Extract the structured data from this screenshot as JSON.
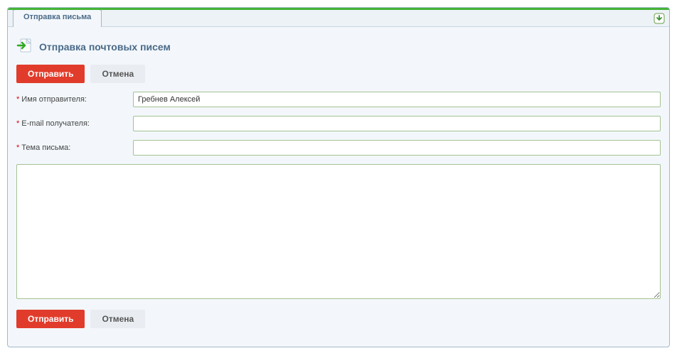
{
  "tab": {
    "label": "Отправка письма"
  },
  "header": {
    "title": "Отправка почтовых писем"
  },
  "buttons": {
    "send": "Отправить",
    "cancel": "Отмена"
  },
  "form": {
    "sender_label": "Имя отправителя:",
    "sender_value": "Гребнев Алексей",
    "recipient_label": "E-mail получателя:",
    "recipient_value": "",
    "subject_label": "Тема письма:",
    "subject_value": "",
    "body_value": "",
    "required_marker": "*"
  }
}
